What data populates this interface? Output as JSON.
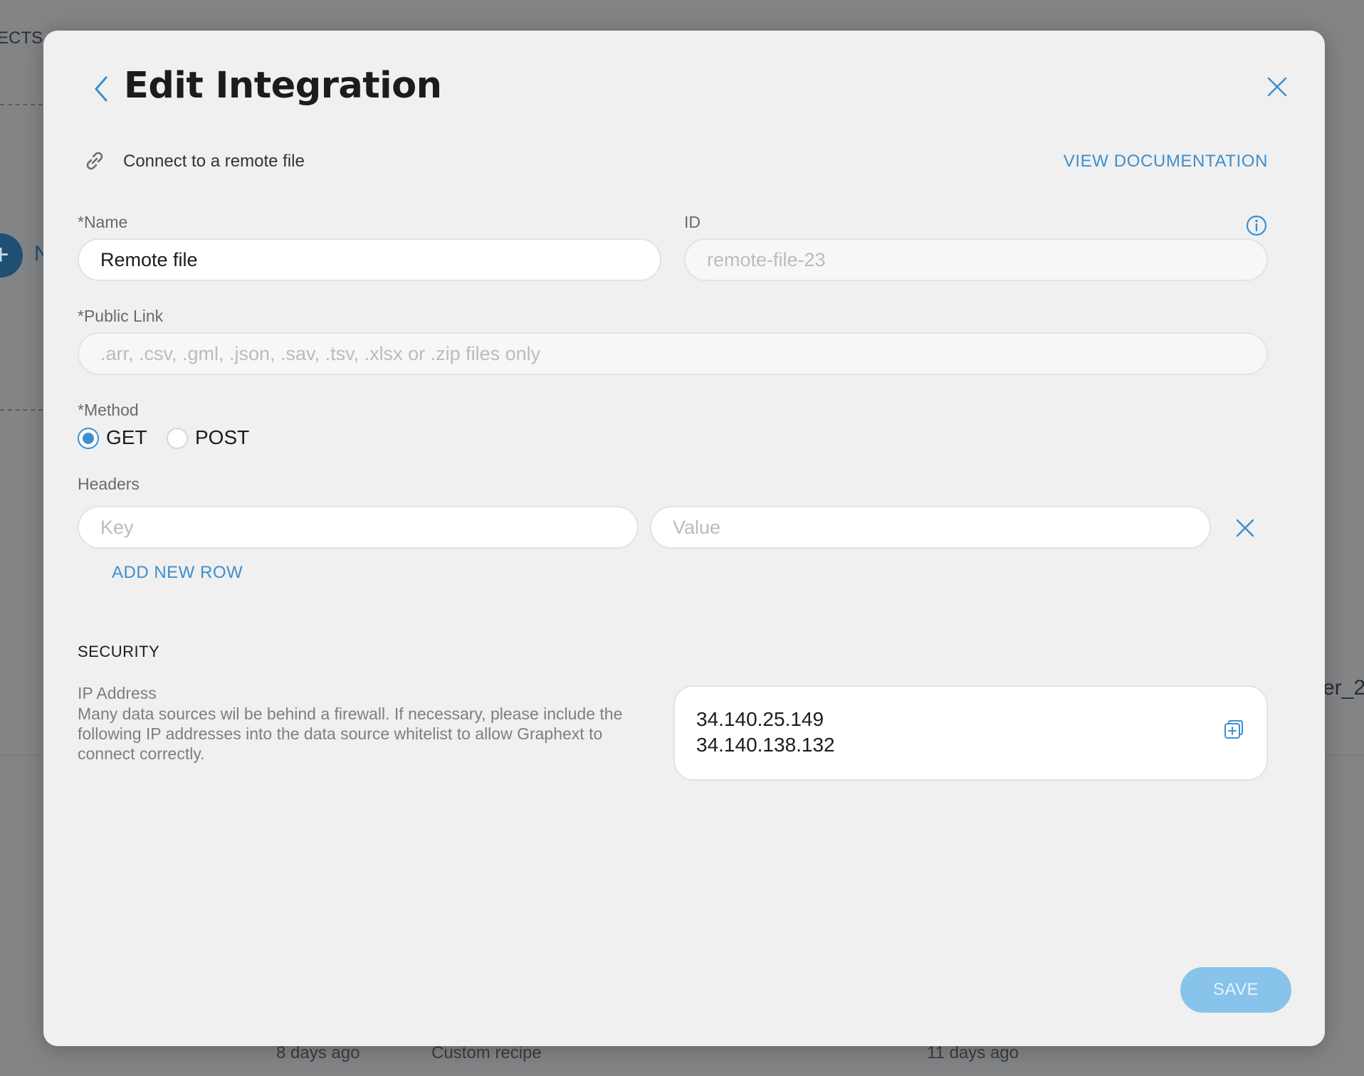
{
  "background": {
    "top_left_text": "ECTS",
    "bottom_texts": [
      "8 days ago",
      "Custom recipe",
      "11 days ago"
    ],
    "right_edge_text": "er_2"
  },
  "modal": {
    "title": "Edit Integration",
    "subtitle": "Connect to a remote file",
    "docs_link": "VIEW DOCUMENTATION",
    "name": {
      "label": "*Name",
      "value": "Remote file"
    },
    "id": {
      "label": "ID",
      "placeholder": "remote-file-23"
    },
    "public_link": {
      "label": "*Public Link",
      "placeholder": ".arr, .csv, .gml, .json, .sav, .tsv, .xlsx or .zip files only"
    },
    "method": {
      "label": "*Method",
      "options": [
        {
          "label": "GET",
          "selected": true
        },
        {
          "label": "POST",
          "selected": false
        }
      ]
    },
    "headers": {
      "label": "Headers",
      "key_placeholder": "Key",
      "value_placeholder": "Value",
      "add_row": "ADD NEW ROW"
    },
    "security": {
      "heading": "SECURITY",
      "ip_title": "IP Address",
      "ip_description": "Many data sources wil be behind a firewall. If necessary, please include the following IP addresses into the data source whitelist to allow Graphext to connect correctly.",
      "ips": [
        "34.140.25.149",
        "34.140.138.132"
      ]
    },
    "save_label": "SAVE",
    "colors": {
      "accent": "#3d8fcd",
      "save_bg": "#87c3ea"
    },
    "icons": [
      "chevron-left-icon",
      "close-icon",
      "link-icon",
      "info-icon",
      "copy-icon"
    ]
  }
}
